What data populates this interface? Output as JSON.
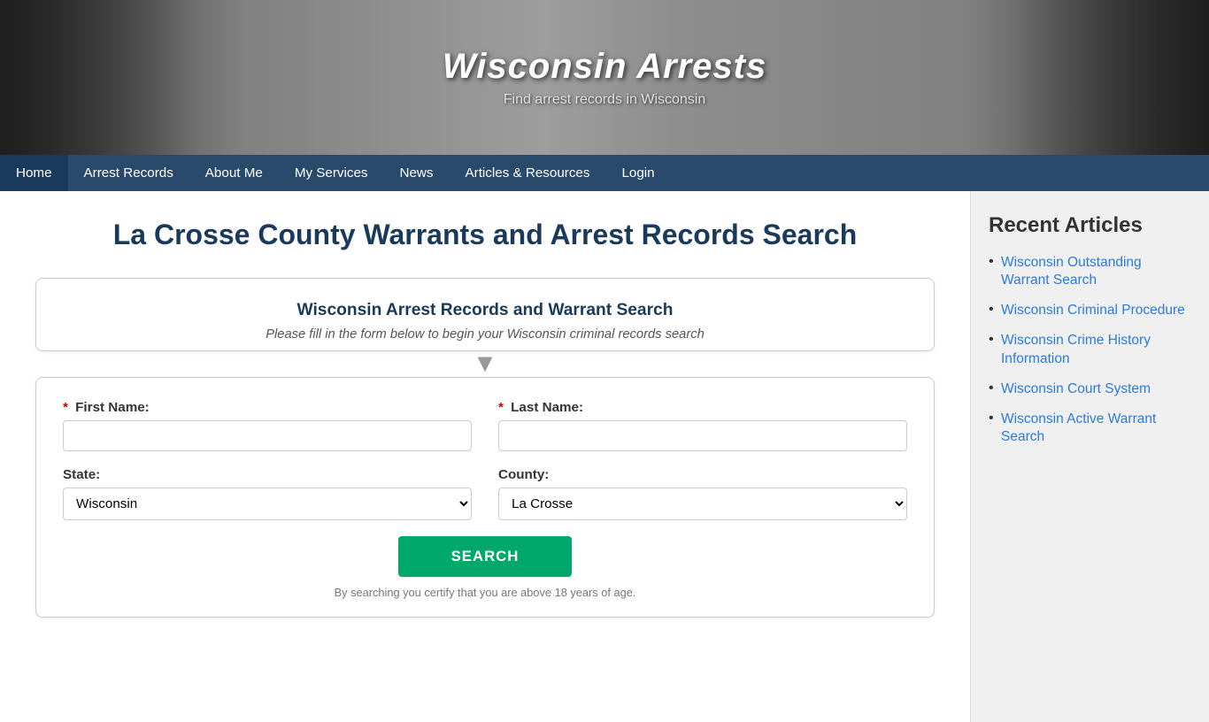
{
  "site": {
    "title": "Wisconsin Arrests",
    "tagline": "Find arrest records in Wisconsin"
  },
  "nav": {
    "items": [
      {
        "label": "Home",
        "active": false
      },
      {
        "label": "Arrest Records",
        "active": false
      },
      {
        "label": "About Me",
        "active": false
      },
      {
        "label": "My Services",
        "active": false
      },
      {
        "label": "News",
        "active": false
      },
      {
        "label": "Articles & Resources",
        "active": false
      },
      {
        "label": "Login",
        "active": false
      }
    ]
  },
  "main": {
    "page_title": "La Crosse County Warrants and Arrest Records Search",
    "search_box_title": "Wisconsin Arrest Records and Warrant Search",
    "search_box_subtitle": "Please fill in the form below to begin your Wisconsin criminal records search",
    "form": {
      "first_name_label": "First Name:",
      "last_name_label": "Last Name:",
      "state_label": "State:",
      "county_label": "County:",
      "state_value": "Wisconsin",
      "county_value": "La Crosse",
      "search_button": "SEARCH",
      "disclaimer": "By searching you certify that you are above 18 years of age."
    }
  },
  "sidebar": {
    "title": "Recent Articles",
    "articles": [
      {
        "label": "Wisconsin Outstanding Warrant Search",
        "url": "#"
      },
      {
        "label": "Wisconsin Criminal Procedure",
        "url": "#"
      },
      {
        "label": "Wisconsin Crime History Information",
        "url": "#"
      },
      {
        "label": "Wisconsin Court System",
        "url": "#"
      },
      {
        "label": "Wisconsin Active Warrant Search",
        "url": "#"
      }
    ]
  }
}
